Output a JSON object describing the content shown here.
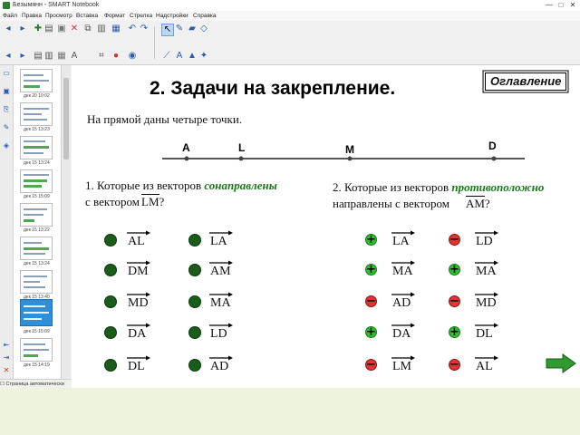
{
  "window": {
    "title": "Безымянн - SMART Notebook",
    "controls": [
      "—",
      "□",
      "✕"
    ]
  },
  "menu": [
    "Файл",
    "Правка",
    "Просмотр",
    "Вставка",
    "Формат",
    "Стрелка",
    "Надстройки",
    "Справка"
  ],
  "thumbnails": [
    {
      "caption": "дек 20 10:02"
    },
    {
      "caption": "дек 15 13:23"
    },
    {
      "caption": "дек 15 13:24"
    },
    {
      "caption": "дек 15 15:09"
    },
    {
      "caption": "дек 15 13:22"
    },
    {
      "caption": "дек 15 13:24"
    },
    {
      "caption": "дек 15 13:40"
    },
    {
      "caption": "дек 15 15:09"
    },
    {
      "caption": "дек 15 14:19"
    }
  ],
  "status": "Страница автоматически",
  "slide": {
    "title": "2. Задачи на  закрепление.",
    "toc_button": "Оглавление",
    "intro": "На прямой даны четыре точки.",
    "points": [
      "A",
      "L",
      "M",
      "D"
    ],
    "q1_line1_a": "1. Которые из векторов ",
    "q1_line1_b": "сонаправлены",
    "q1_line2": "с вектором",
    "q1_vector": "LM",
    "q_mark": "?",
    "q2_line1_a": "2. Которые из векторов ",
    "q2_line1_b": "противоположно",
    "q2_line2": "направлены с вектором",
    "q2_vector": "AM",
    "q1_col1": [
      "AL",
      "DM",
      "MD",
      "DA",
      "DL"
    ],
    "q1_col2": [
      "LA",
      "AM",
      "MA",
      "LD",
      "AD"
    ],
    "q2_col1": [
      {
        "vec": "LA",
        "mark": "+"
      },
      {
        "vec": "MA",
        "mark": "+"
      },
      {
        "vec": "AD",
        "mark": "−"
      },
      {
        "vec": "DA",
        "mark": "+"
      },
      {
        "vec": "LM",
        "mark": "−"
      }
    ],
    "q2_col2": [
      {
        "vec": "LD",
        "mark": "−"
      },
      {
        "vec": "MA",
        "mark": "+"
      },
      {
        "vec": "MD",
        "mark": "−"
      },
      {
        "vec": "DL",
        "mark": "+"
      },
      {
        "vec": "AL",
        "mark": "−"
      }
    ]
  },
  "colors": {
    "correct": "#2fbf2f",
    "wrong": "#e03333",
    "dot": "#1a5c1a",
    "accent": "#1a7a1a"
  }
}
